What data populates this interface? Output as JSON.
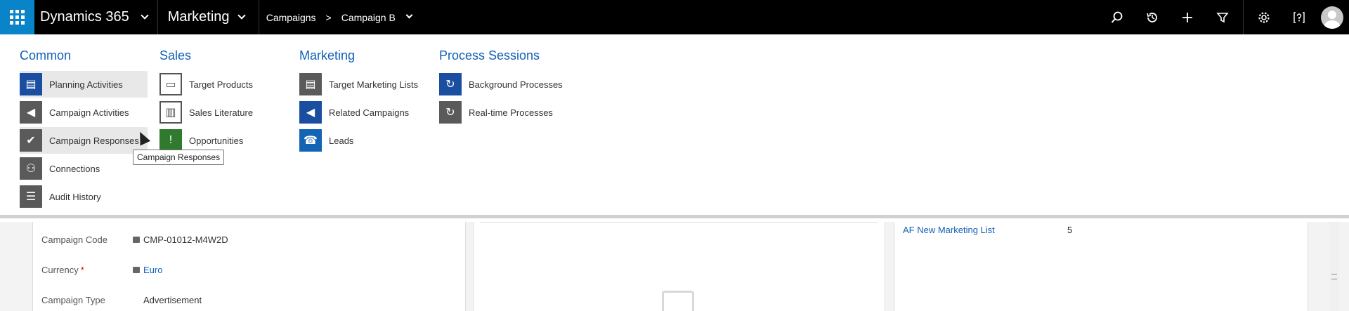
{
  "topbar": {
    "app_name": "Dynamics 365",
    "area": "Marketing",
    "breadcrumb": [
      "Campaigns",
      "Campaign B"
    ],
    "breadcrumb_separator": ">"
  },
  "menu": {
    "columns": [
      {
        "title": "Common",
        "items": [
          {
            "label": "Planning Activities",
            "icon": "planning-activities-icon"
          },
          {
            "label": "Campaign Activities",
            "icon": "campaign-activities-icon"
          },
          {
            "label": "Campaign Responses",
            "icon": "campaign-responses-icon"
          },
          {
            "label": "Connections",
            "icon": "connections-icon"
          },
          {
            "label": "Audit History",
            "icon": "audit-history-icon"
          }
        ]
      },
      {
        "title": "Sales",
        "items": [
          {
            "label": "Target Products",
            "icon": "target-products-icon"
          },
          {
            "label": "Sales Literature",
            "icon": "sales-literature-icon"
          },
          {
            "label": "Opportunities",
            "icon": "opportunities-icon"
          }
        ]
      },
      {
        "title": "Marketing",
        "items": [
          {
            "label": "Target Marketing Lists",
            "icon": "target-marketing-lists-icon"
          },
          {
            "label": "Related Campaigns",
            "icon": "related-campaigns-icon"
          },
          {
            "label": "Leads",
            "icon": "leads-icon"
          }
        ]
      },
      {
        "title": "Process Sessions",
        "items": [
          {
            "label": "Background Processes",
            "icon": "background-processes-icon"
          },
          {
            "label": "Real-time Processes",
            "icon": "real-time-processes-icon"
          }
        ]
      }
    ],
    "tooltip": "Campaign Responses"
  },
  "form": {
    "fields": [
      {
        "label": "Campaign Code",
        "value": "CMP-01012-M4W2D",
        "locked": true,
        "required": false
      },
      {
        "label": "Currency",
        "value": "Euro",
        "locked": true,
        "required": true
      },
      {
        "label": "Campaign Type",
        "value": "Advertisement",
        "locked": false,
        "required": false
      }
    ],
    "required_marker": "*",
    "marketing_list": {
      "name": "AF New Marketing List",
      "count": "5"
    }
  }
}
